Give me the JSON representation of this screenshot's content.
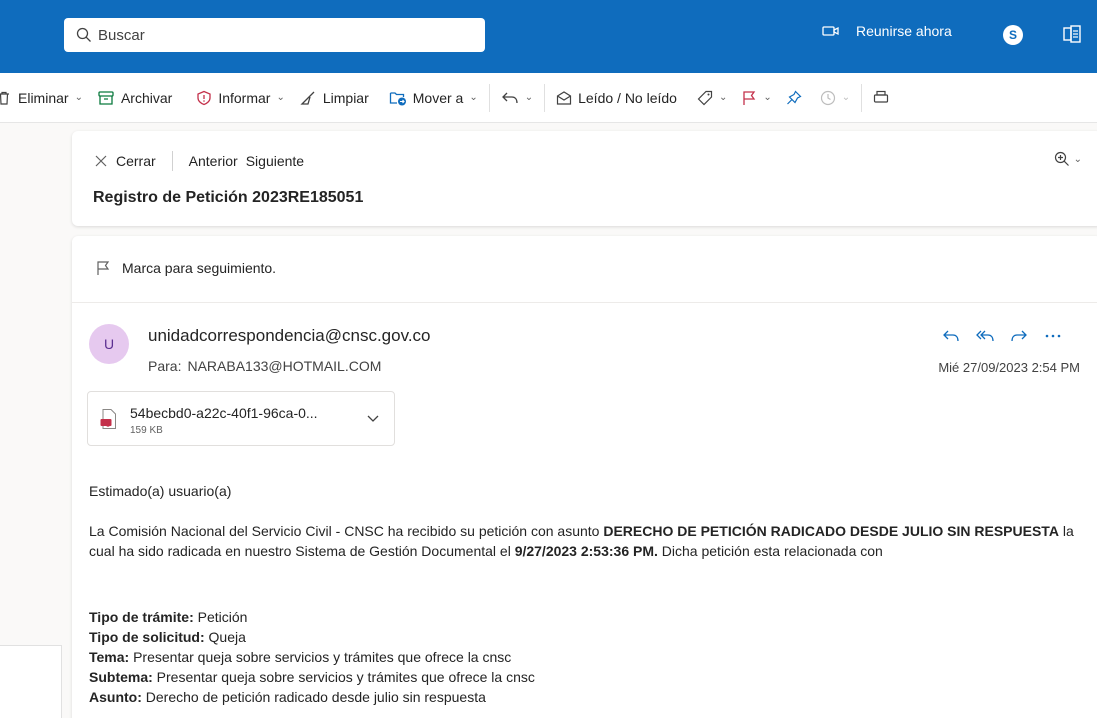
{
  "search": {
    "placeholder": "Buscar"
  },
  "topbar": {
    "meet_label": "Reunirse ahora",
    "skype_letter": "S"
  },
  "toolbar": {
    "delete": "Eliminar",
    "archive": "Archivar",
    "report": "Informar",
    "sweep": "Limpiar",
    "move": "Mover a",
    "read_unread": "Leído / No leído"
  },
  "header": {
    "close": "Cerrar",
    "previous": "Anterior",
    "next": "Siguiente",
    "subject": "Registro de Petición 2023RE185051"
  },
  "message": {
    "flag_label": "Marca para seguimiento.",
    "avatar_initial": "U",
    "sender": "unidadcorrespondencia@cnsc.gov.co",
    "to_label": "Para:",
    "to_value": "NARABA133@HOTMAIL.COM",
    "date": "Mié 27/09/2023 2:54 PM",
    "attachment": {
      "name": "54becbd0-a22c-40f1-96ca-0...",
      "size": "159 KB"
    },
    "greeting": "Estimado(a) usuario(a)",
    "para": {
      "p1": "La Comisión Nacional del Servicio Civil - CNSC ha recibido su petición con asunto ",
      "b1": "DERECHO DE PETICIÓN RADICADO DESDE JULIO SIN RESPUESTA",
      "p2": " la cual ha sido radicada en nuestro Sistema de Gestión Documental el ",
      "b2": "9/27/2023 2:53:36 PM.",
      "p3": " Dicha petición esta relacionada con"
    },
    "fields": [
      {
        "label": "Tipo de trámite:",
        "value": " Petición"
      },
      {
        "label": "Tipo de solicitud:",
        "value": " Queja"
      },
      {
        "label": "Tema:",
        "value": " Presentar queja sobre servicios y trámites que ofrece la cnsc"
      },
      {
        "label": "Subtema:",
        "value": " Presentar queja sobre servicios y trámites que ofrece la cnsc"
      },
      {
        "label": "Asunto:",
        "value": " Derecho de petición radicado desde julio sin respuesta"
      }
    ]
  }
}
